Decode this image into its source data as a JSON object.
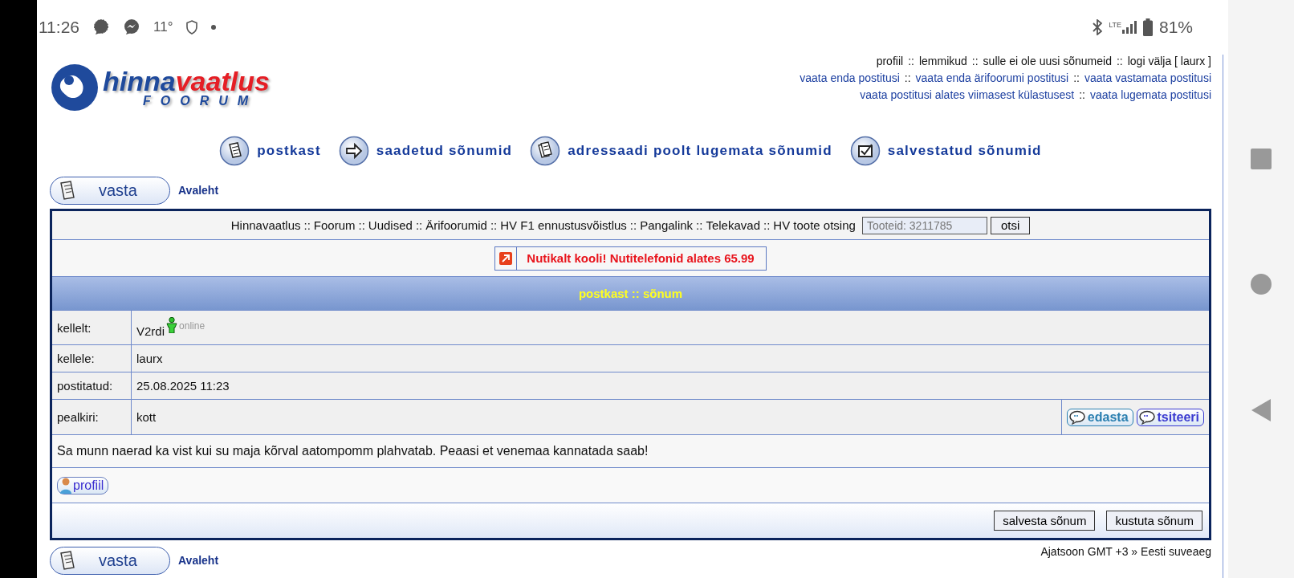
{
  "status_bar": {
    "time": "11:26",
    "temperature": "11°",
    "battery": "81%",
    "network": "LTE"
  },
  "header": {
    "logo_title_a": "hinna",
    "logo_title_b": "vaatlus",
    "logo_subtitle": "FOORUM",
    "separator": "::",
    "user_links": [
      "profiil",
      "lemmikud",
      "sulle ei ole uusi sõnumeid",
      "logi välja [ laurx ]"
    ],
    "search_links_1": [
      "vaata enda postitusi",
      "vaata enda ärifoorumi postitusi",
      "vaata vastamata postitusi"
    ],
    "search_links_2": [
      "vaata postitusi alates viimasest külastusest",
      "vaata lugemata postitusi"
    ]
  },
  "pm_nav": [
    {
      "label": "postkast",
      "kind": "inbox"
    },
    {
      "label": "saadetud sõnumid",
      "kind": "sent"
    },
    {
      "label": "adressaadi poolt lugemata sõnumid",
      "kind": "outbox"
    },
    {
      "label": "salvestatud sõnumid",
      "kind": "saved"
    }
  ],
  "top_actions": {
    "reply": "vasta",
    "home": "Avaleht"
  },
  "site_nav": {
    "links": [
      "Hinnavaatlus",
      "Foorum",
      "Uudised",
      "Ärifoorumid",
      "HV F1 ennustusvõistlus",
      "Pangalink",
      "Telekavad",
      "HV toote otsing"
    ],
    "separator": "::",
    "search": {
      "placeholder": "Tooteid: 3211785"
    },
    "search_button": "otsi"
  },
  "ad": {
    "text": "Nutikalt kooli! Nutitelefonid alates 65.99"
  },
  "panel_title": "postkast :: sõnum",
  "fields": [
    {
      "label": "kellelt:",
      "value": "V2rdi",
      "status": "online"
    },
    {
      "label": "kellele:",
      "value": "laurx"
    },
    {
      "label": "postitatud:",
      "value": "25.08.2025 11:23"
    },
    {
      "label": "pealkiri:",
      "value": "kott",
      "actions": [
        {
          "label": "edasta",
          "kind": "forward"
        },
        {
          "label": "tsiteeri",
          "kind": "quote"
        }
      ]
    }
  ],
  "message": "Sa munn naerad ka vist kui su maja kõrval aatompomm plahvatab. Peaasi et venemaa kannatada saab!",
  "profile_button": "profiil",
  "message_actions": [
    "salvesta sõnum",
    "kustuta sõnum"
  ],
  "bottom_actions": {
    "reply": "vasta",
    "home": "Avaleht"
  },
  "timezone": "Ajatsoon GMT +3 » Eesti suveaeg"
}
